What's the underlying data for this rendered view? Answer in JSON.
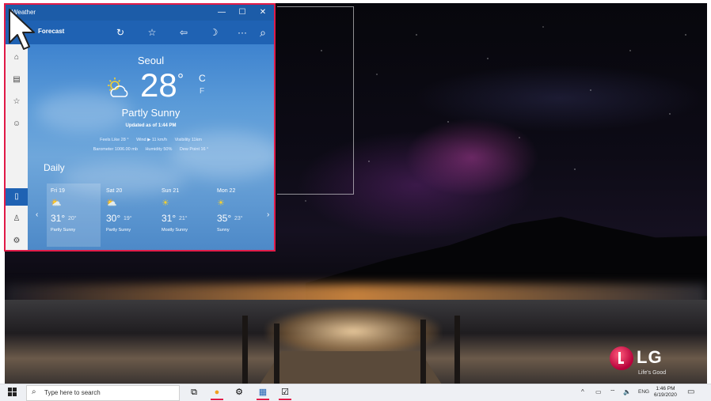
{
  "window": {
    "title": "Weather",
    "controls": {
      "minimize": "—",
      "maximize": "☐",
      "close": "✕"
    }
  },
  "toolbar": {
    "section_label": "Forecast",
    "icons": [
      "refresh-icon",
      "favorite-star-icon",
      "pin-icon",
      "dark-mode-moon-icon",
      "more-icon",
      "search-icon"
    ],
    "glyphs": {
      "refresh": "↻",
      "star": "☆",
      "pin": "⇦",
      "moon": "☽",
      "more": "···",
      "search": "⌕"
    }
  },
  "sidebar": {
    "items": [
      {
        "name": "home",
        "glyph": "⌂"
      },
      {
        "name": "maps",
        "glyph": "▤"
      },
      {
        "name": "favorites",
        "glyph": "☆"
      },
      {
        "name": "life",
        "glyph": "☺"
      },
      {
        "name": "device",
        "glyph": "▯"
      },
      {
        "name": "account",
        "glyph": "♙"
      },
      {
        "name": "settings",
        "glyph": "⚙"
      }
    ]
  },
  "current": {
    "city": "Seoul",
    "temperature": "28",
    "degree": "°",
    "unit_c": "C",
    "unit_f": "F",
    "condition": "Partly Sunny",
    "updated": "Updated as of 1:44 PM",
    "feels_like": "Feels Like  28 °",
    "wind": "Wind  ▶ 11 km/h",
    "visibility": "Visibility  11km",
    "barometer": "Barometer  1006.00 mb",
    "humidity": "Humidity  50%",
    "dew_point": "Dew Point  16 °"
  },
  "daily": {
    "title": "Daily",
    "days": [
      {
        "name": "Fri 19",
        "icon": "partly-sunny-icon",
        "glyph": "⛅",
        "high": "31°",
        "low": "20°",
        "condition": "Partly Sunny"
      },
      {
        "name": "Sat 20",
        "icon": "partly-sunny-icon",
        "glyph": "⛅",
        "high": "30°",
        "low": "19°",
        "condition": "Partly Sunny"
      },
      {
        "name": "Sun 21",
        "icon": "sun-icon",
        "glyph": "☀",
        "high": "31°",
        "low": "21°",
        "condition": "Mostly Sunny"
      },
      {
        "name": "Mon 22",
        "icon": "sun-icon",
        "glyph": "☀",
        "high": "35°",
        "low": "23°",
        "condition": "Sunny"
      }
    ],
    "prev": "‹",
    "next": "›"
  },
  "desktop": {
    "brand": "LG",
    "tagline": "Life's Good"
  },
  "taskbar": {
    "search_placeholder": "Type here to search",
    "clock_time": "1:46 PM",
    "clock_date": "6/19/2020",
    "language": "ENG",
    "tray_glyphs": {
      "chevron": "^",
      "battery": "▭",
      "network": "⌔",
      "volume": "🔈",
      "notifications": "▭"
    },
    "apps": [
      {
        "name": "task-view",
        "glyph": "⧉"
      },
      {
        "name": "browser",
        "glyph": "●"
      },
      {
        "name": "settings",
        "glyph": "⚙"
      },
      {
        "name": "store",
        "glyph": "▦"
      },
      {
        "name": "weather-app",
        "glyph": "☑"
      }
    ]
  },
  "colors": {
    "highlight_border": "#e11b48",
    "titlebar": "#1c5ca8",
    "toolbar": "#1f62b3",
    "sun": "#f5d130"
  }
}
